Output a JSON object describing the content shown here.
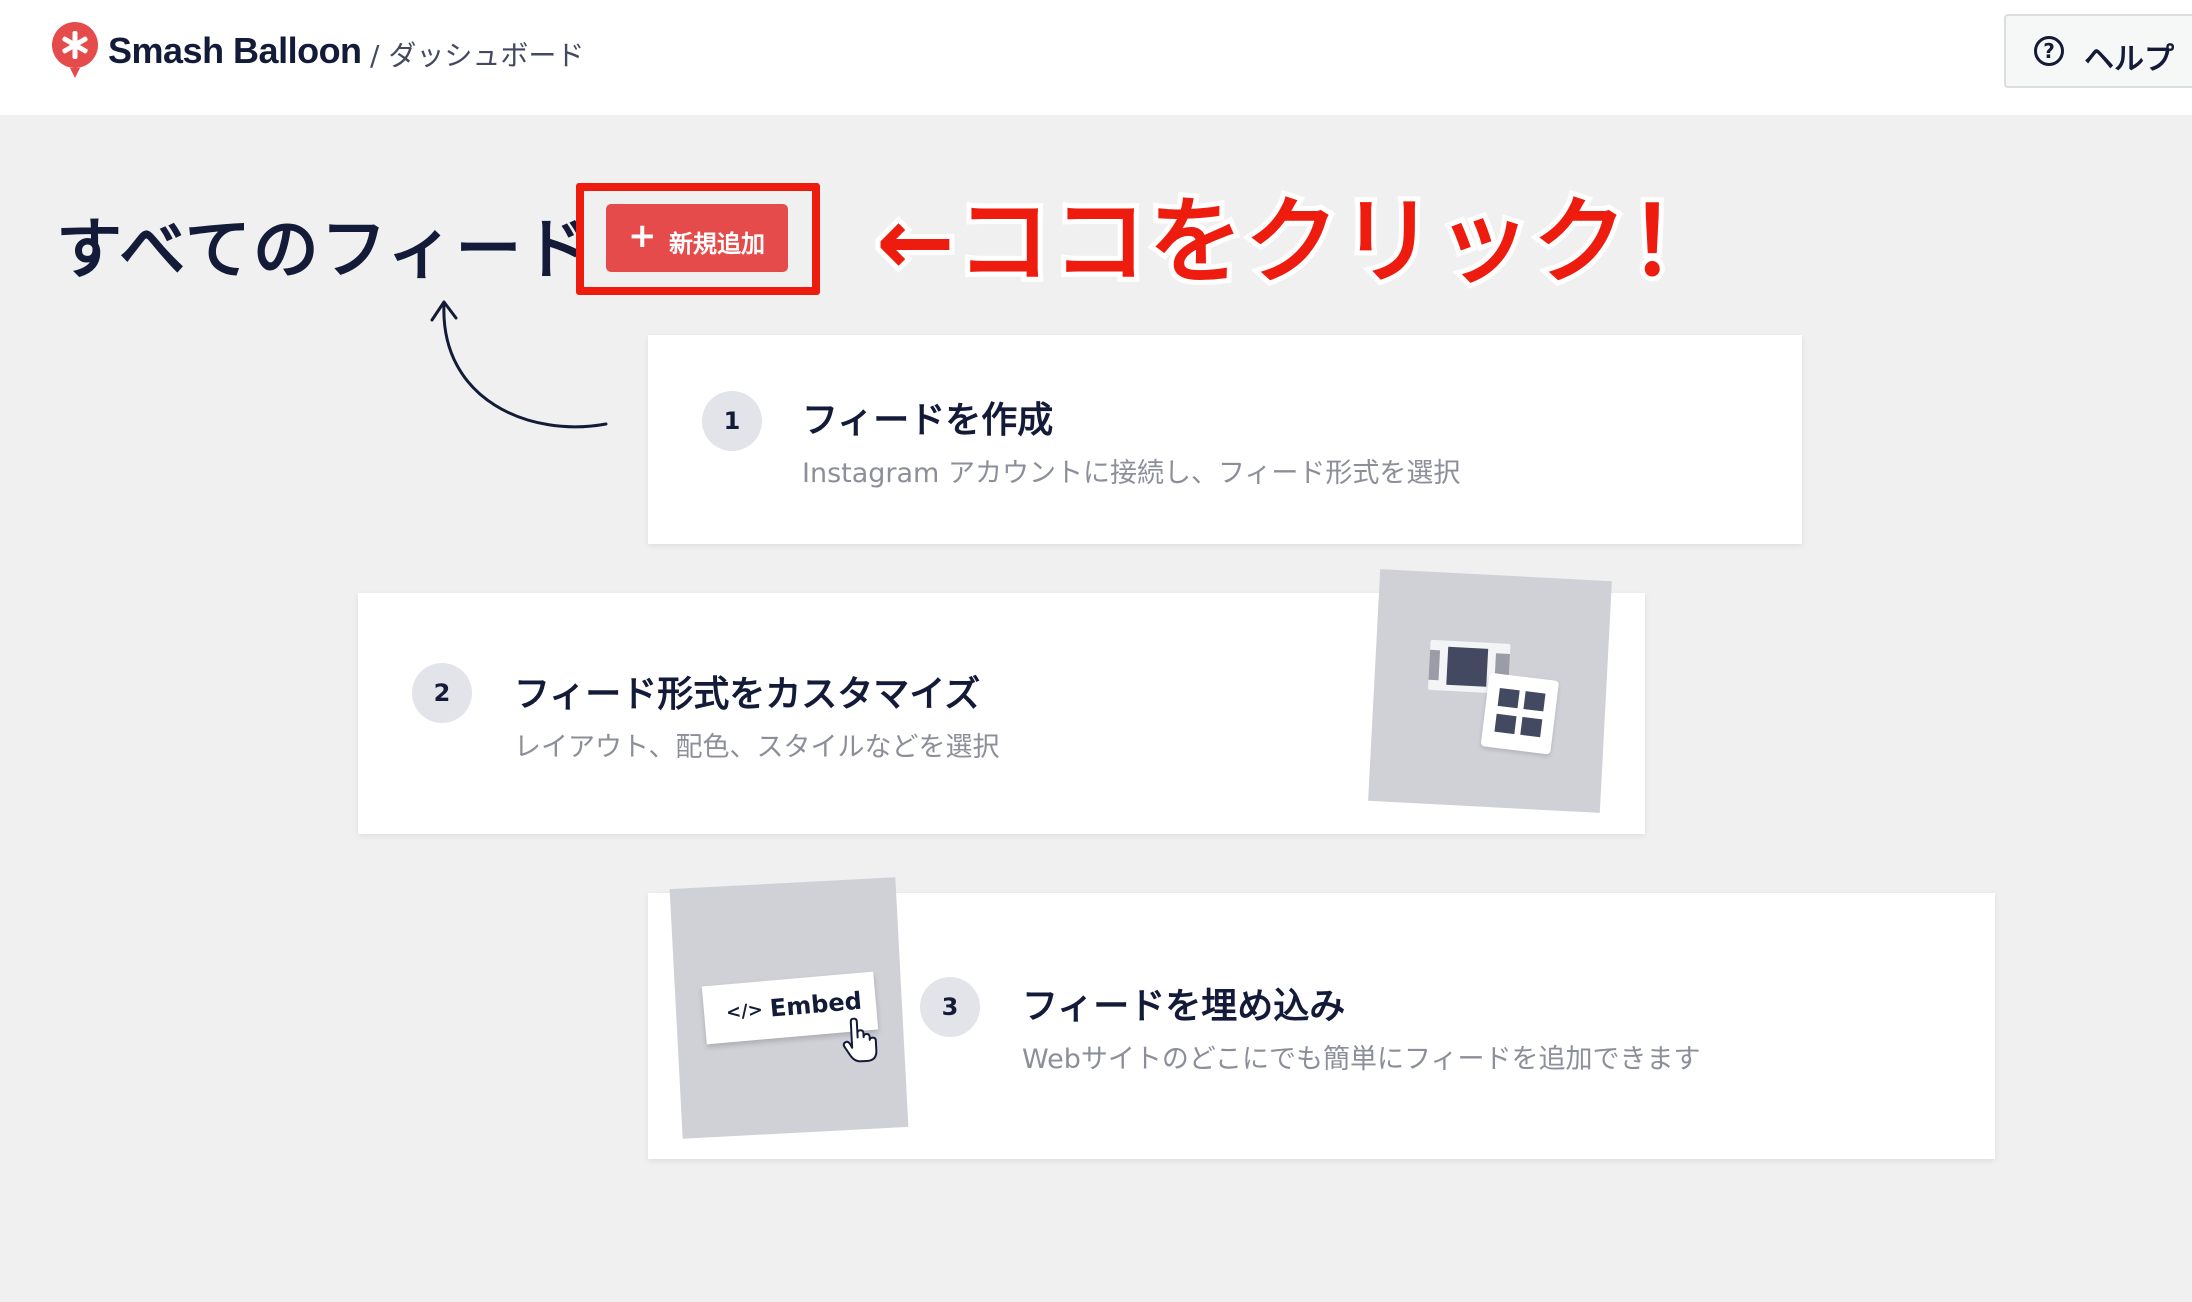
{
  "header": {
    "brand": "Smash Balloon",
    "breadcrumb": "/ ダッシュボード",
    "help_label": "ヘルプ"
  },
  "main": {
    "title": "すべてのフィード",
    "add_button_plus": "+",
    "add_button_label": "新規追加",
    "annotation": "←ココをクリック！"
  },
  "steps": [
    {
      "number": "1",
      "title": "フィードを作成",
      "description": "Instagram アカウントに接続し、フィード形式を選択"
    },
    {
      "number": "2",
      "title": "フィード形式をカスタマイズ",
      "description": "レイアウト、配色、スタイルなどを選択"
    },
    {
      "number": "3",
      "title": "フィードを埋め込み",
      "description": "Webサイトのどこにでも簡単にフィードを追加できます",
      "illustration_label": "Embed",
      "illustration_code": "</>"
    }
  ],
  "colors": {
    "brand_red": "#e54b4b",
    "annotation_red": "#ee1c0f",
    "text_dark": "#141b38",
    "text_muted": "#8c8f9a",
    "page_bg": "#f0f0f1"
  },
  "icons": [
    "balloon-logo-icon",
    "help-circle-icon",
    "plus-icon",
    "curved-arrow-icon",
    "code-icon",
    "hand-pointer-icon"
  ]
}
